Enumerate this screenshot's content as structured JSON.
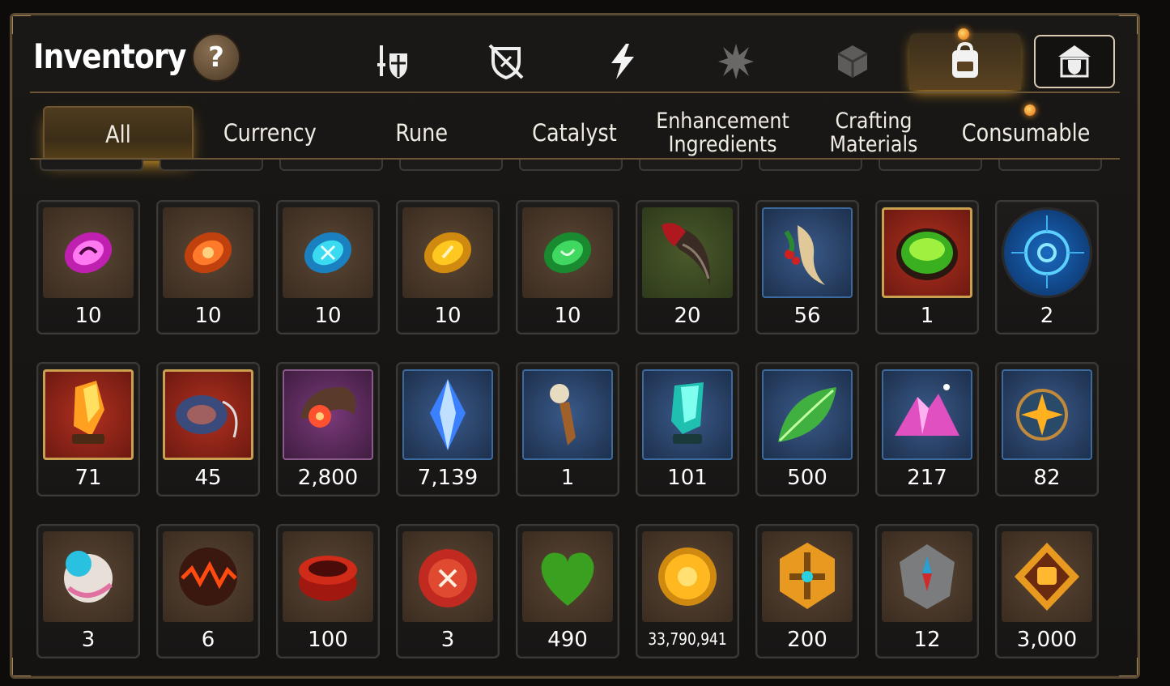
{
  "header": {
    "title": "Inventory",
    "help_label": "?"
  },
  "category_tabs": [
    {
      "name": "equipment",
      "icon": "sword-shield-icon"
    },
    {
      "name": "disabled",
      "icon": "crossed-shield-icon"
    },
    {
      "name": "skill",
      "icon": "lightning-icon"
    },
    {
      "name": "awakening",
      "icon": "burst-icon"
    },
    {
      "name": "cube",
      "icon": "cube-icon"
    },
    {
      "name": "bag",
      "icon": "backpack-icon",
      "active": true,
      "notification": true
    },
    {
      "name": "guild",
      "icon": "guild-hall-icon"
    }
  ],
  "sub_tabs": [
    {
      "label": "All",
      "active": true
    },
    {
      "label": "Currency"
    },
    {
      "label": "Rune"
    },
    {
      "label": "Catalyst"
    },
    {
      "label": "Enhancement Ingredients"
    },
    {
      "label": "Crafting Materials"
    },
    {
      "label": "Consumable",
      "notification": true
    }
  ],
  "items": [
    [
      {
        "icon": "purple-rune-icon",
        "qty": "10"
      },
      {
        "icon": "fire-rune-icon",
        "qty": "10"
      },
      {
        "icon": "ice-rune-icon",
        "qty": "10"
      },
      {
        "icon": "light-rune-icon",
        "qty": "10"
      },
      {
        "icon": "wind-rune-icon",
        "qty": "10"
      },
      {
        "icon": "beast-claw-icon",
        "qty": "20"
      },
      {
        "icon": "root-herb-icon",
        "qty": "56"
      },
      {
        "icon": "green-gem-icon",
        "qty": "1"
      },
      {
        "icon": "portal-seal-icon",
        "qty": "2"
      }
    ],
    [
      {
        "icon": "amber-crystal-icon",
        "qty": "71"
      },
      {
        "icon": "pendant-icon",
        "qty": "45"
      },
      {
        "icon": "flower-charm-icon",
        "qty": "2,800"
      },
      {
        "icon": "blue-crystal-icon",
        "qty": "7,139"
      },
      {
        "icon": "bookmark-icon",
        "qty": "1"
      },
      {
        "icon": "teal-crystal-icon",
        "qty": "101"
      },
      {
        "icon": "leaf-icon",
        "qty": "500"
      },
      {
        "icon": "pink-ore-icon",
        "qty": "217"
      },
      {
        "icon": "star-amulet-icon",
        "qty": "82"
      }
    ],
    [
      {
        "icon": "scroll-icon",
        "qty": "3"
      },
      {
        "icon": "lava-orb-icon",
        "qty": "6"
      },
      {
        "icon": "red-bracelet-icon",
        "qty": "100"
      },
      {
        "icon": "seal-badge-icon",
        "qty": "3"
      },
      {
        "icon": "heart-icon",
        "qty": "490"
      },
      {
        "icon": "gold-coin-icon",
        "qty": "33,790,941"
      },
      {
        "icon": "gold-emblem-icon",
        "qty": "200"
      },
      {
        "icon": "stone-compass-icon",
        "qty": "12"
      },
      {
        "icon": "fist-medal-icon",
        "qty": "3,000"
      }
    ]
  ],
  "colors": {
    "frame_border": "#5a4a33",
    "accent_gold": "#e3a02a",
    "panel_bg": "#141311"
  }
}
